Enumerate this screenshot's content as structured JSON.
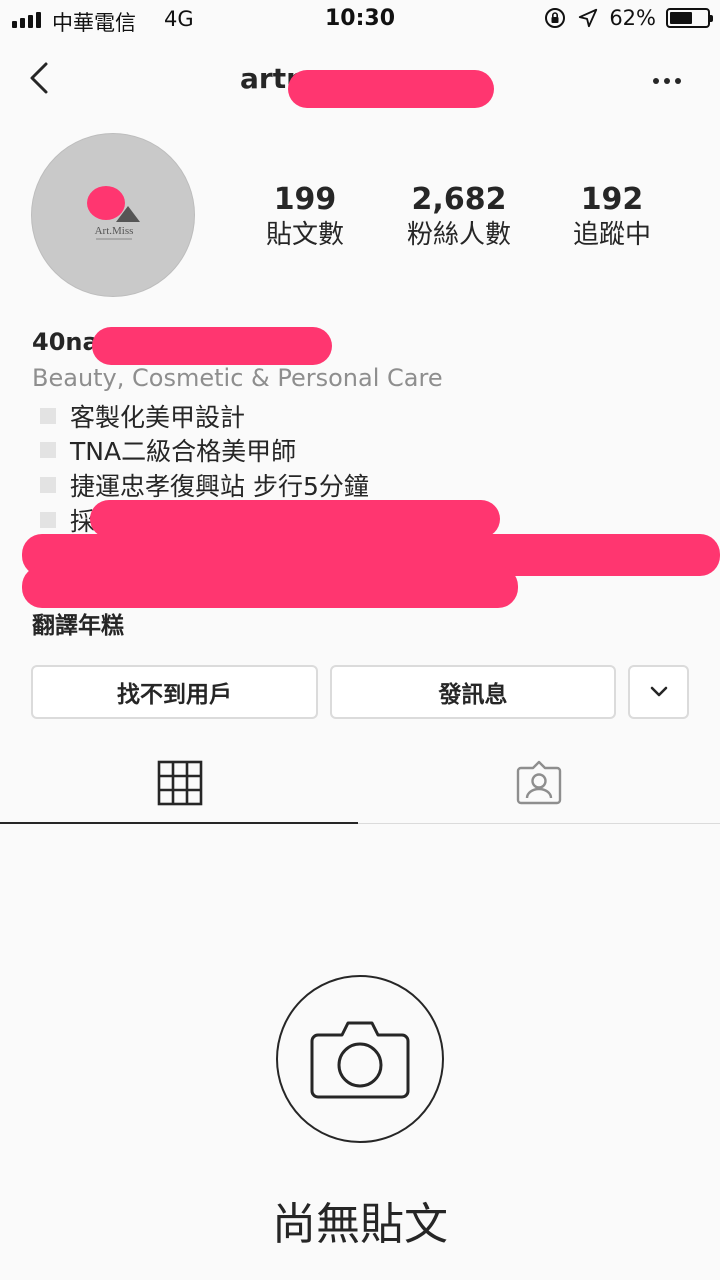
{
  "status_bar": {
    "carrier": "中華電信",
    "network": "4G",
    "time": "10:30",
    "battery": "62%",
    "battery_level": 0.62,
    "signal_icon": "signal-bars-icon",
    "lock_icon": "orientation-lock-icon",
    "location_icon": "location-arrow-icon"
  },
  "header": {
    "username_visible": "artr",
    "back_icon": "chevron-left-icon",
    "more_icon": "more-horizontal-icon"
  },
  "profile": {
    "avatar_logo_text": "Art.Miss",
    "stats": [
      {
        "value": "199",
        "label": "貼文數"
      },
      {
        "value": "2,682",
        "label": "粉絲人數"
      },
      {
        "value": "192",
        "label": "追蹤中"
      }
    ],
    "name_visible": "40na",
    "category": "Beauty, Cosmetic & Personal Care",
    "bio_lines": [
      "客製化美甲設計",
      "TNA二級合格美甲師",
      "捷運忠孝復興站 步行5分鐘",
      "採"
    ],
    "translate_label": "翻譯年糕"
  },
  "actions": {
    "user_not_found": "找不到用戶",
    "message": "發訊息",
    "dropdown_icon": "chevron-down-icon"
  },
  "tabs": {
    "grid_icon": "grid-icon",
    "tagged_icon": "tagged-person-icon",
    "active": "grid"
  },
  "empty_state": {
    "icon": "camera-icon",
    "text": "尚無貼文"
  },
  "colors": {
    "redaction": "#ff3670",
    "background": "#fafafa",
    "text": "#262626",
    "secondary_text": "#8e8e8e",
    "border": "#dbdbdb"
  }
}
